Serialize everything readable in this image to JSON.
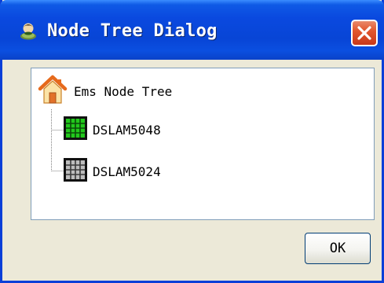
{
  "window": {
    "title": "Node Tree Dialog",
    "title_icon": "user-node-icon",
    "close_icon": "close-icon",
    "accent_color": "#0a49df",
    "close_color": "#e2572e"
  },
  "tree": {
    "root": {
      "label": "Ems Node Tree",
      "icon": "home-icon"
    },
    "children": [
      {
        "label": "DSLAM5048",
        "icon": "grid-node-icon",
        "status_color": "#22c81c"
      },
      {
        "label": "DSLAM5024",
        "icon": "grid-node-icon",
        "status_color": "#7a7a7a"
      }
    ]
  },
  "buttons": {
    "ok_label": "OK"
  }
}
